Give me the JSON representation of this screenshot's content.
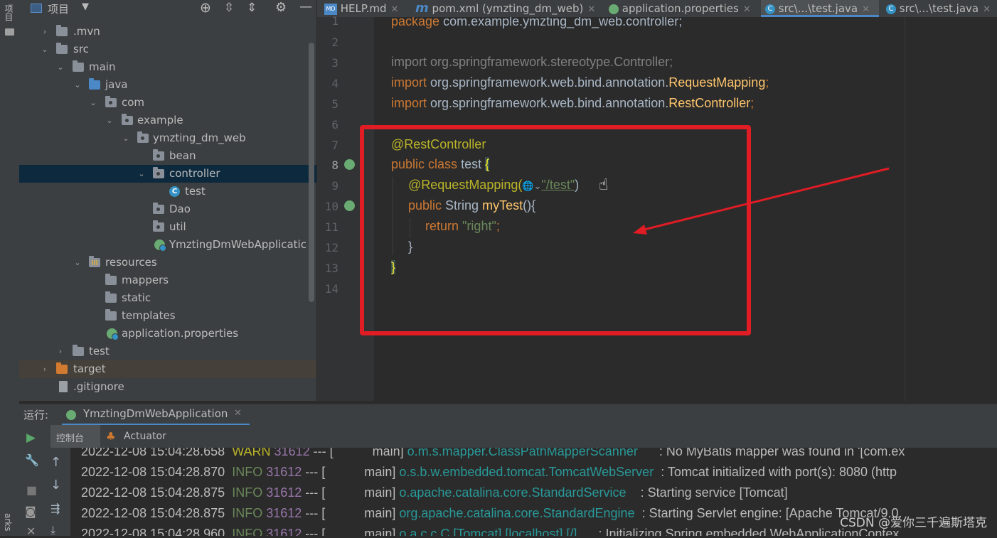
{
  "left_strip": {
    "top_label": "项目",
    "bottom_label": "arks"
  },
  "project_panel": {
    "title": "项目",
    "tree": [
      {
        "label": ".mvn",
        "arrow": "›"
      },
      {
        "label": "src",
        "arrow": "⌄"
      },
      {
        "label": "main",
        "arrow": "⌄"
      },
      {
        "label": "java",
        "arrow": "⌄"
      },
      {
        "label": "com",
        "arrow": "⌄"
      },
      {
        "label": "example",
        "arrow": "⌄"
      },
      {
        "label": "ymzting_dm_web",
        "arrow": "⌄"
      },
      {
        "label": "bean",
        "arrow": ""
      },
      {
        "label": "controller",
        "arrow": "⌄"
      },
      {
        "label": "test",
        "arrow": "",
        "icon_letter": "C"
      },
      {
        "label": "Dao",
        "arrow": ""
      },
      {
        "label": "util",
        "arrow": ""
      },
      {
        "label": "YmztingDmWebApplicatic",
        "arrow": ""
      },
      {
        "label": "resources",
        "arrow": "⌄"
      },
      {
        "label": "mappers",
        "arrow": ""
      },
      {
        "label": "static",
        "arrow": ""
      },
      {
        "label": "templates",
        "arrow": ""
      },
      {
        "label": "application.properties",
        "arrow": ""
      },
      {
        "label": "test",
        "arrow": "›"
      },
      {
        "label": "target",
        "arrow": "›"
      },
      {
        "label": ".gitignore",
        "arrow": ""
      }
    ]
  },
  "editor_tabs": [
    {
      "label": "HELP.md",
      "icon": "md-file-icon",
      "badge": "MD"
    },
    {
      "label": "pom.xml (ymzting_dm_web)",
      "icon": "maven-icon",
      "badge": "m"
    },
    {
      "label": "application.properties",
      "icon": "spring-properties-icon",
      "badge": ""
    },
    {
      "label": "src\\...\\test.java",
      "icon": "java-class-icon",
      "badge": "C"
    },
    {
      "label": "src\\...\\test.java",
      "icon": "java-class-icon",
      "badge": "C"
    }
  ],
  "line_numbers": [
    "1",
    "2",
    "3",
    "4",
    "5",
    "6",
    "7",
    "8",
    "9",
    "10",
    "11",
    "12",
    "13",
    "14"
  ],
  "code": {
    "l1": {
      "kw": "package",
      "rest": "com.example.ymzting_dm_web.controller;"
    },
    "l3": {
      "text": "import org.springframework.stereotype.Controller;"
    },
    "l4": {
      "kw": "import",
      "pkg": "org.springframework.web.bind.annotation.",
      "cls": "RequestMapping",
      "end": ";"
    },
    "l5": {
      "kw": "import",
      "pkg": "org.springframework.web.bind.annotation.",
      "cls": "RestController",
      "end": ";"
    },
    "l7": {
      "annotation": "@RestController"
    },
    "l8": {
      "kw": "public class",
      "name": "test",
      "brace": "{"
    },
    "l9": {
      "annotation": "@RequestMapping(",
      "globe": "🌐",
      "chev": "⌄",
      "str": "\"/test\"",
      "end": ")"
    },
    "l10": {
      "kw": "public",
      "type": "String",
      "method": "myTest",
      "end": "(){"
    },
    "l11": {
      "kw": "return",
      "str": "\"right\"",
      "end": ";"
    },
    "l12": {
      "text": "}"
    },
    "l13": {
      "text": "}"
    }
  },
  "run_panel": {
    "label": "运行:",
    "config_name": "YmztingDmWebApplication",
    "tab_console": "控制台",
    "tab_actuator": "Actuator"
  },
  "console_lines": [
    {
      "ts": "2022-12-08 15:04:28.658",
      "level": "WARN",
      "pid": "31612",
      "sep": "---",
      "thread": "[           main]",
      "logger": "o.m.s.mapper.ClassPathMapperScanner",
      "msg": ": No MyBatis mapper was found in '[com.ex"
    },
    {
      "ts": "2022-12-08 15:04:28.870",
      "level": "INFO",
      "pid": "31612",
      "sep": "---",
      "thread": "[           main]",
      "logger": "o.s.b.w.embedded.tomcat.TomcatWebServer",
      "msg": ": Tomcat initialized with port(s): 8080 (http"
    },
    {
      "ts": "2022-12-08 15:04:28.875",
      "level": "INFO",
      "pid": "31612",
      "sep": "---",
      "thread": "[           main]",
      "logger": "o.apache.catalina.core.StandardService",
      "msg": ": Starting service [Tomcat]"
    },
    {
      "ts": "2022-12-08 15:04:28.875",
      "level": "INFO",
      "pid": "31612",
      "sep": "---",
      "thread": "[           main]",
      "logger": "org.apache.catalina.core.StandardEngine",
      "msg": ": Starting Servlet engine: [Apache Tomcat/9.0."
    },
    {
      "ts": "2022-12-08 15:04:28.960",
      "level": "INFO",
      "pid": "31612",
      "sep": "---",
      "thread": "[           main]",
      "logger": "o.a.c.c.C.[Tomcat].[localhost].[/]",
      "msg": ": Initializing Spring embedded WebApplicationContex"
    }
  ],
  "watermark": "CSDN @爱你三千遍斯塔克",
  "colors": {
    "accent": "#4a88c7",
    "annotation_box": "#e01c24",
    "selection": "#0d293e"
  }
}
